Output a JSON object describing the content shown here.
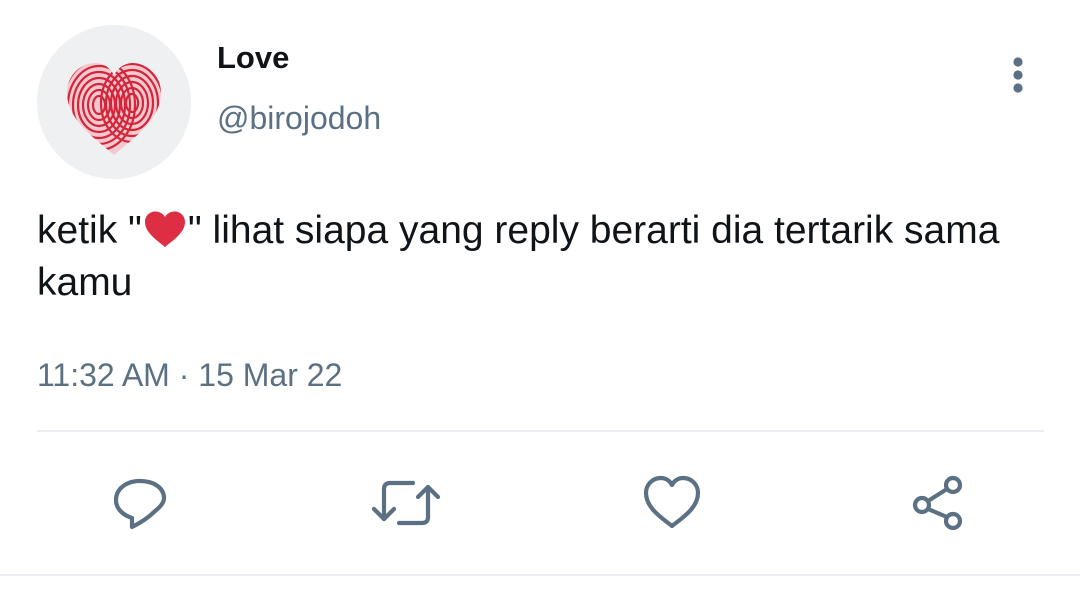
{
  "tweet": {
    "display_name": "Love",
    "handle": "@birojodoh",
    "text_part1": "ketik \"",
    "text_part2": "\" lihat siapa yang reply berarti dia tertarik sama kamu",
    "timestamp": "11:32 AM · 15 Mar 22"
  },
  "icons": {
    "avatar": "fingerprint-heart-avatar",
    "more": "more-vertical-icon",
    "emoji": "red-heart-emoji",
    "reply": "reply-icon",
    "retweet": "retweet-icon",
    "like": "like-heart-icon",
    "share": "share-icon"
  },
  "colors": {
    "text_primary": "#0f1419",
    "text_secondary": "#5b7083",
    "icon": "#5b7083",
    "divider": "#ebeef0",
    "heart_red": "#dd2e44"
  }
}
